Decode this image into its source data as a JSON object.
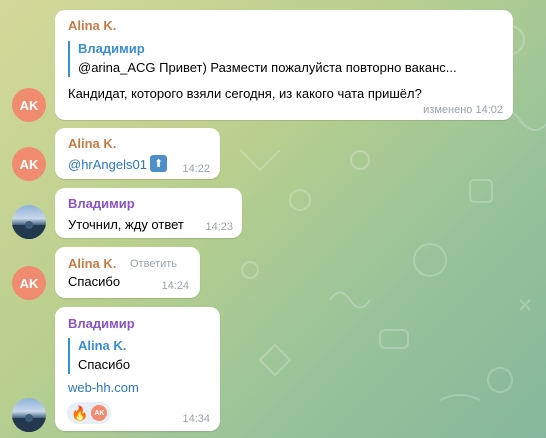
{
  "messages": [
    {
      "sender": "Alina K.",
      "avatar_initials": "AK",
      "reply_name": "Владимир",
      "reply_text": "@arina_ACG Привет) Размести пожалуйста повторно ваканс...",
      "text": "Кандидат, которого взяли сегодня, из какого чата пришёл?",
      "time": "изменено 14:02"
    },
    {
      "sender": "Alina K.",
      "avatar_initials": "AK",
      "text": "@hrAngels01",
      "time": "14:22"
    },
    {
      "sender": "Владимир",
      "text": "Уточнил, жду ответ",
      "time": "14:23"
    },
    {
      "sender": "Alina K.",
      "avatar_initials": "AK",
      "reply_button": "Ответить",
      "text": "Спасибо",
      "time": "14:24"
    },
    {
      "sender": "Владимир",
      "reply_name": "Alina K.",
      "reply_text": "Спасибо",
      "text": "web-hh.com",
      "reaction_avatar": "AK",
      "time": "14:34"
    }
  ],
  "colors": {
    "sender_alina": "#c67c45",
    "sender_vladimir": "#8a53c6",
    "link": "#2a78c3",
    "avatar_ak": "#f08b70"
  },
  "icons": [
    "upvote-icon",
    "fire-reaction-icon"
  ]
}
